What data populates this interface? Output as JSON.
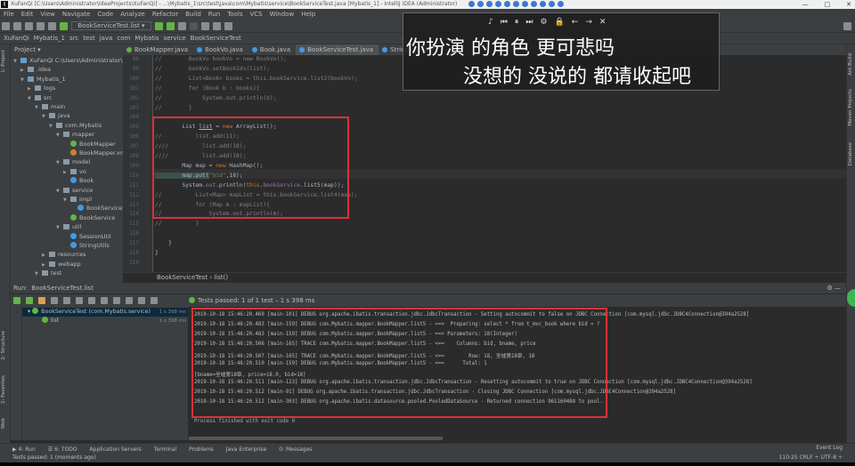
{
  "window": {
    "title": "XuFanQi [C:\\Users\\Administrator\\IdeaProjects\\XuFanQi] - ...\\Mybatis_1\\src\\test\\java\\com\\Mybatis\\service\\BookServiceTest.java [Mybatis_1] - IntelliJ IDEA (Administrator)",
    "logo": "IJ",
    "controls": [
      "—",
      "□",
      "✕"
    ]
  },
  "menu": [
    "File",
    "Edit",
    "View",
    "Navigate",
    "Code",
    "Analyze",
    "Refactor",
    "Build",
    "Run",
    "Tools",
    "VCS",
    "Window",
    "Help"
  ],
  "toolbar": {
    "run_config": "BookServiceTest.list ▾"
  },
  "navbar": [
    "XuFanQi",
    "Mybatis_1",
    "src",
    "test",
    "java",
    "com",
    "Mybatis",
    "service",
    "BookServiceTest"
  ],
  "tabs": [
    {
      "label": "BookMapper.java"
    },
    {
      "label": "BookVo.java"
    },
    {
      "label": "Book.java"
    },
    {
      "label": "BookServiceTest.java",
      "active": true
    },
    {
      "label": "StringUtils.java"
    }
  ],
  "project": {
    "header": "Project ▾",
    "tree": [
      {
        "label": "XuFanQi  C:\\Users\\Administrator\\IdeaProjects",
        "depth": 0,
        "type": "module",
        "open": true
      },
      {
        "label": ".idea",
        "depth": 1,
        "type": "folder"
      },
      {
        "label": "Mybatis_1",
        "depth": 1,
        "type": "module",
        "open": true
      },
      {
        "label": "logs",
        "depth": 2,
        "type": "folder"
      },
      {
        "label": "src",
        "depth": 2,
        "type": "folder",
        "open": true
      },
      {
        "label": "main",
        "depth": 3,
        "type": "folder",
        "open": true
      },
      {
        "label": "java",
        "depth": 4,
        "type": "folder",
        "open": true
      },
      {
        "label": "com.Mybatis",
        "depth": 5,
        "type": "folder",
        "open": true
      },
      {
        "label": "mapper",
        "depth": 6,
        "type": "folder",
        "open": true
      },
      {
        "label": "BookMapper",
        "depth": 7,
        "type": "interface"
      },
      {
        "label": "BookMapper.xml",
        "depth": 7,
        "type": "xml"
      },
      {
        "label": "model",
        "depth": 6,
        "type": "folder",
        "open": true
      },
      {
        "label": "vo",
        "depth": 7,
        "type": "folder"
      },
      {
        "label": "Book",
        "depth": 7,
        "type": "class"
      },
      {
        "label": "service",
        "depth": 6,
        "type": "folder",
        "open": true
      },
      {
        "label": "impl",
        "depth": 7,
        "type": "folder",
        "open": true
      },
      {
        "label": "BookServiceImpl",
        "depth": 8,
        "type": "class"
      },
      {
        "label": "BookService",
        "depth": 7,
        "type": "interface"
      },
      {
        "label": "util",
        "depth": 6,
        "type": "folder",
        "open": true
      },
      {
        "label": "SessionUtil",
        "depth": 7,
        "type": "class"
      },
      {
        "label": "StringUtils",
        "depth": 7,
        "type": "class"
      },
      {
        "label": "resources",
        "depth": 4,
        "type": "folder"
      },
      {
        "label": "webapp",
        "depth": 4,
        "type": "folder"
      },
      {
        "label": "test",
        "depth": 3,
        "type": "folder",
        "open": true
      }
    ]
  },
  "editor": {
    "lines": [
      {
        "n": "98",
        "parts": [
          [
            "cm",
            "//        BookVo bookVo = new BookVo();"
          ]
        ]
      },
      {
        "n": "99",
        "parts": [
          [
            "cm",
            "//        bookVo.setBookIds(list);"
          ]
        ]
      },
      {
        "n": "100",
        "parts": [
          [
            "cm",
            "//        List<Book> books = this.bookService.list2(bookVo);"
          ]
        ]
      },
      {
        "n": "101",
        "parts": [
          [
            "cm",
            "//        for (Book b : books){"
          ]
        ]
      },
      {
        "n": "102",
        "parts": [
          [
            "cm",
            "//            System.out.println(b);"
          ]
        ]
      },
      {
        "n": "103",
        "parts": [
          [
            "cm",
            "//        }"
          ]
        ]
      },
      {
        "n": "104",
        "parts": []
      },
      {
        "n": "105",
        "parts": [
          [
            "",
            "        List "
          ],
          [
            "u",
            "list"
          ],
          [
            "",
            " = "
          ],
          [
            "kw",
            "new"
          ],
          [
            "",
            " ArrayList();"
          ]
        ]
      },
      {
        "n": "106",
        "parts": [
          [
            "cm",
            "//          list.add(11);"
          ]
        ]
      },
      {
        "n": "107",
        "parts": [
          [
            "cm",
            "////          list.add(18);"
          ]
        ]
      },
      {
        "n": "108",
        "parts": [
          [
            "cm",
            "////          list.add(18);"
          ]
        ]
      },
      {
        "n": "109",
        "parts": [
          [
            "",
            "        Map map = "
          ],
          [
            "kw",
            "new"
          ],
          [
            "",
            " HashMap();"
          ]
        ]
      },
      {
        "n": "110",
        "parts": [
          [
            "",
            "        map.put("
          ],
          [
            "str",
            "\"bid\""
          ],
          [
            "",
            ",18);"
          ]
        ]
      },
      {
        "n": "111",
        "parts": [
          [
            "",
            "        System."
          ],
          [
            "fld",
            "out"
          ],
          [
            "",
            ".println("
          ],
          [
            "kw",
            "this"
          ],
          [
            "",
            "."
          ],
          [
            "fld",
            "bookService"
          ],
          [
            "",
            ".list5(map));"
          ]
        ]
      },
      {
        "n": "112",
        "parts": [
          [
            "cm",
            "//          List<Map> mapList = this.bookService.list4(map);"
          ]
        ]
      },
      {
        "n": "113",
        "parts": [
          [
            "cm",
            "//          for (Map m : mapList){"
          ]
        ]
      },
      {
        "n": "114",
        "parts": [
          [
            "cm",
            "//              System.out.println(m);"
          ]
        ]
      },
      {
        "n": "115",
        "parts": [
          [
            "cm",
            "//          }"
          ]
        ]
      },
      {
        "n": "116",
        "parts": []
      },
      {
        "n": "117",
        "parts": [
          [
            "",
            "    }"
          ]
        ]
      },
      {
        "n": "118",
        "parts": [
          [
            "",
            "}"
          ]
        ]
      },
      {
        "n": "119",
        "parts": []
      }
    ]
  },
  "breadcrumb": [
    "BookServiceTest",
    "›",
    "list()"
  ],
  "run": {
    "label": "Run:",
    "config": "BookServiceTest.list",
    "tests_result": "Tests passed: 1 of 1 test – 1 s 398 ms",
    "tree": [
      {
        "label": "BookServiceTest (com.Mybatis.service)",
        "time": "1 s 398 ms"
      },
      {
        "label": "list",
        "time": "1 s 398 ms"
      }
    ],
    "console": [
      "2019-10-18 15:46:20.469 [main-101] DEBUG org.apache.ibatis.transaction.jdbc.JdbcTransaction - Setting autocommit to false on JDBC Connection [com.mysql.jdbc.JDBC4Connection@394a2528]",
      "2019-10-18 15:46:20.483 [main-159] DEBUG com.Mybatis.mapper.BookMapper.list5 - ==>  Preparing: select * from t_mvc_book where bid = ?",
      "2019-10-18 15:46:20.483 [main-159] DEBUG com.Mybatis.mapper.BookMapper.list5 - ==> Parameters: 18(Integer)",
      "2019-10-18 15:46:20.506 [main-165] TRACE com.Mybatis.mapper.BookMapper.list5 - <==    Columns: bid, bname, price",
      "2019-10-18 15:46:20.507 [main-165] TRACE com.Mybatis.mapper.BookMapper.list5 - <==        Row: 18, 圣墟第18章, 18",
      "2019-10-18 15:46:20.510 [main-159] DEBUG com.Mybatis.mapper.BookMapper.list5 - <==      Total: 1",
      "[bname=圣墟第18章, price=18.0, bid=18]",
      "2019-10-18 15:46:20.511 [main-123] DEBUG org.apache.ibatis.transaction.jdbc.JdbcTransaction - Resetting autocommit to true on JDBC Connection [com.mysql.jdbc.JDBC4Connection@394a2528]",
      "2019-10-18 15:46:20.512 [main-91] DEBUG org.apache.ibatis.transaction.jdbc.JdbcTransaction - Closing JDBC Connection [com.mysql.jdbc.JDBC4Connection@394a2528]",
      "2019-10-18 15:46:20.512 [main-303] DEBUG org.apache.ibatis.datasource.pooled.PooledDataSource - Returned connection 961160488 to pool."
    ],
    "finished": "Process finished with exit code 0"
  },
  "bottom_tabs": [
    "▶ 4: Run",
    "☰ 6: TODO",
    "Application Servers",
    "Terminal",
    "Problems",
    "Java Enterprise",
    "0: Messages"
  ],
  "event_log": "Event Log",
  "status": {
    "left": "Tests passed: 1 (moments ago)",
    "right": "110:25   CRLF ÷   UTF-8 ÷"
  },
  "side_labels": {
    "left": [
      "1: Project",
      "2: Structure",
      "2: Favorites",
      "Web"
    ],
    "right": [
      "Ant Build",
      "Maven Projects",
      "Database"
    ]
  },
  "overlay": {
    "media_controls": [
      "♪",
      "⏮",
      "⏸",
      "⏭",
      "⚙",
      "🔒",
      "←",
      "→",
      "✕"
    ],
    "lyric_line1": "你扮演 的角色 更可悲吗",
    "lyric_line2": "没想的 没说的 都请收起吧"
  },
  "colors": {
    "highlight_box": "#d9323a",
    "success": "#62b543",
    "accent": "#4a88c7"
  }
}
